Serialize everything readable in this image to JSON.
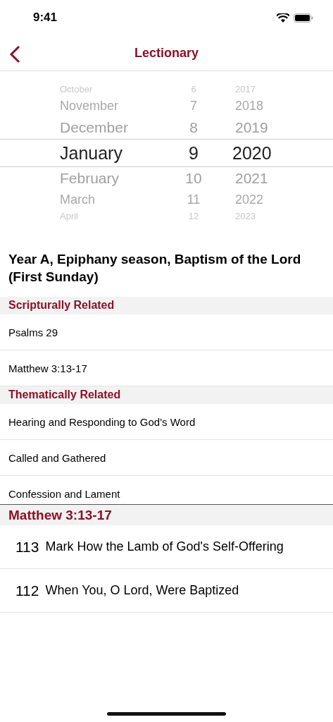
{
  "status_bar": {
    "time": "9:41"
  },
  "nav": {
    "title": "Lectionary"
  },
  "picker": {
    "rows": [
      {
        "month": "October",
        "day": "6",
        "year": "2017",
        "selected": false
      },
      {
        "month": "November",
        "day": "7",
        "year": "2018",
        "selected": false
      },
      {
        "month": "December",
        "day": "8",
        "year": "2019",
        "selected": false
      },
      {
        "month": "January",
        "day": "9",
        "year": "2020",
        "selected": true
      },
      {
        "month": "February",
        "day": "10",
        "year": "2021",
        "selected": false
      },
      {
        "month": "March",
        "day": "11",
        "year": "2022",
        "selected": false
      },
      {
        "month": "April",
        "day": "12",
        "year": "2023",
        "selected": false
      }
    ]
  },
  "heading": "Year A, Epiphany season, Baptism of the Lord (First Sunday)",
  "sections": [
    {
      "title": "Scripturally Related",
      "items": [
        "Psalms 29",
        "Matthew 3:13-17"
      ]
    },
    {
      "title": "Thematically Related",
      "items": [
        "Hearing and Responding to God's Word",
        "Called and Gathered",
        "Confession and Lament"
      ]
    }
  ],
  "hymns": {
    "title": "Matthew 3:13-17",
    "rows": [
      {
        "number": "113",
        "title": "Mark How the Lamb of God's Self-Offering"
      },
      {
        "number": "112",
        "title": "When You, O Lord, Were Baptized"
      }
    ]
  }
}
